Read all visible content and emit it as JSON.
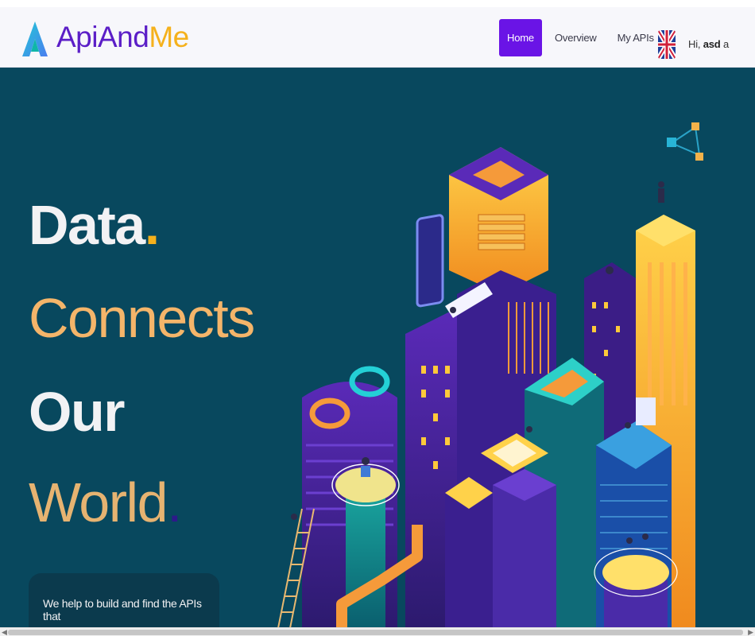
{
  "brand": {
    "api": "ApiAnd",
    "me": "Me",
    "accent": "#f5b11c",
    "primary": "#5b1ec7"
  },
  "nav": {
    "items": [
      {
        "label": "Home",
        "active": true
      },
      {
        "label": "Overview",
        "active": false
      },
      {
        "label": "My APIs",
        "active": false
      }
    ]
  },
  "language": {
    "icon": "uk-flag-icon"
  },
  "user": {
    "greeting": "Hi,",
    "name": "asd",
    "initial": "a"
  },
  "hero": {
    "line1": "Data",
    "line1_dot": ".",
    "line2": "Connects",
    "line3": "Our",
    "line4": "World",
    "line4_dot": ".",
    "blurb": "We help to build and find the APIs that",
    "background": "#08485e"
  }
}
